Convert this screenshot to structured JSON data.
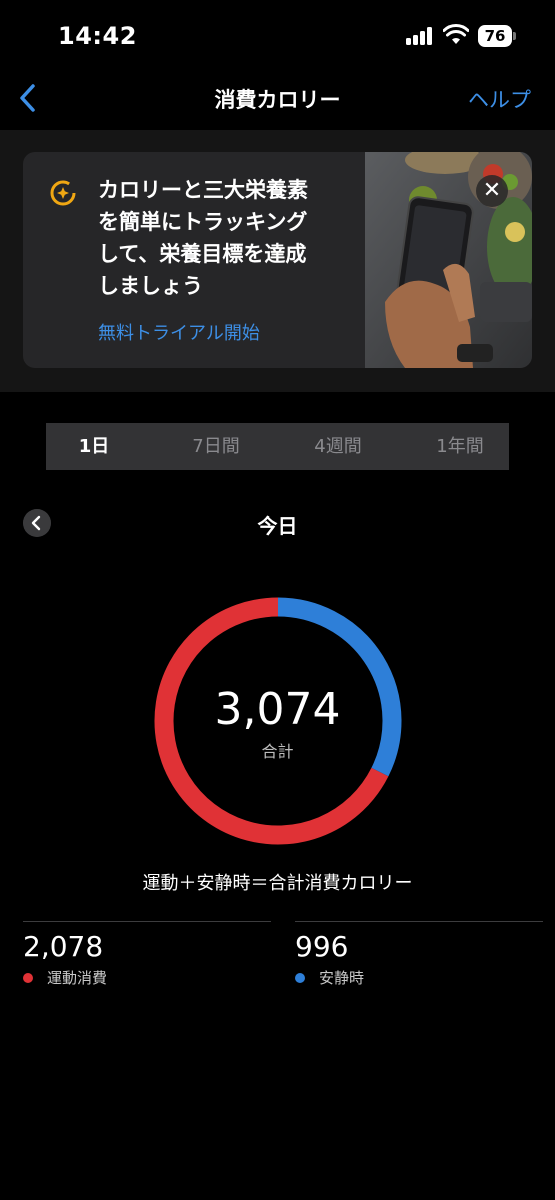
{
  "status_bar": {
    "time": "14:42",
    "battery": "76"
  },
  "nav": {
    "back_icon": "chevron-left-icon",
    "title": "消費カロリー",
    "help_label": "ヘルプ"
  },
  "promo": {
    "lines": [
      "カロリーと三大栄養素",
      "を簡単にトラッキング",
      "して、栄養目標を達成",
      "しましょう"
    ],
    "link_label": "無料トライアル開始",
    "icon": "nutrition-target-icon",
    "close_icon": "close-icon"
  },
  "segments": [
    {
      "label": "1日",
      "active": true
    },
    {
      "label": "7日間",
      "active": false
    },
    {
      "label": "4週間",
      "active": false
    },
    {
      "label": "1年間",
      "active": false
    }
  ],
  "date": {
    "title": "今日",
    "prev_icon": "chevron-left-icon"
  },
  "donut": {
    "total": "3,074",
    "total_label": "合計"
  },
  "equation": "運動＋安静時＝合計消費カロリー",
  "stats": [
    {
      "value": "2,078",
      "label": "運動消費",
      "color": "#e03236",
      "amount": 2078
    },
    {
      "value": "996",
      "label": "安静時",
      "color": "#2e7fd8",
      "amount": 996
    }
  ],
  "colors": {
    "accent": "#3d8fe6",
    "active_red": "#e03236",
    "resting_blue": "#2e7fd8",
    "brand_gold": "#f0a713"
  }
}
